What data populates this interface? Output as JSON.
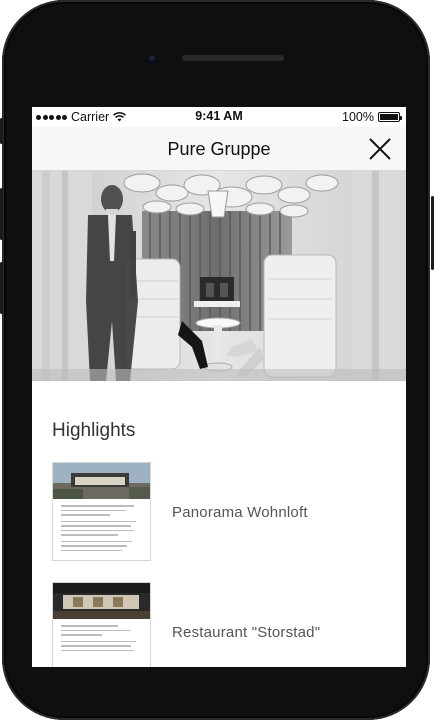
{
  "status_bar": {
    "carrier": "Carrier",
    "time": "9:41 AM",
    "battery": "100%",
    "battery_level": 1.0
  },
  "nav": {
    "title": "Pure Gruppe",
    "close_icon": "close-icon"
  },
  "highlights": {
    "title": "Highlights",
    "items": [
      {
        "label": "Panorama Wohnloft",
        "icon": "document-thumbnail"
      },
      {
        "label": "Restaurant \"Storstad\"",
        "icon": "document-thumbnail"
      }
    ]
  },
  "colors": {
    "nav_background": "#f7f7f7",
    "text": "#111111",
    "muted_text": "#555555",
    "device_frame": "#0f0f10"
  }
}
